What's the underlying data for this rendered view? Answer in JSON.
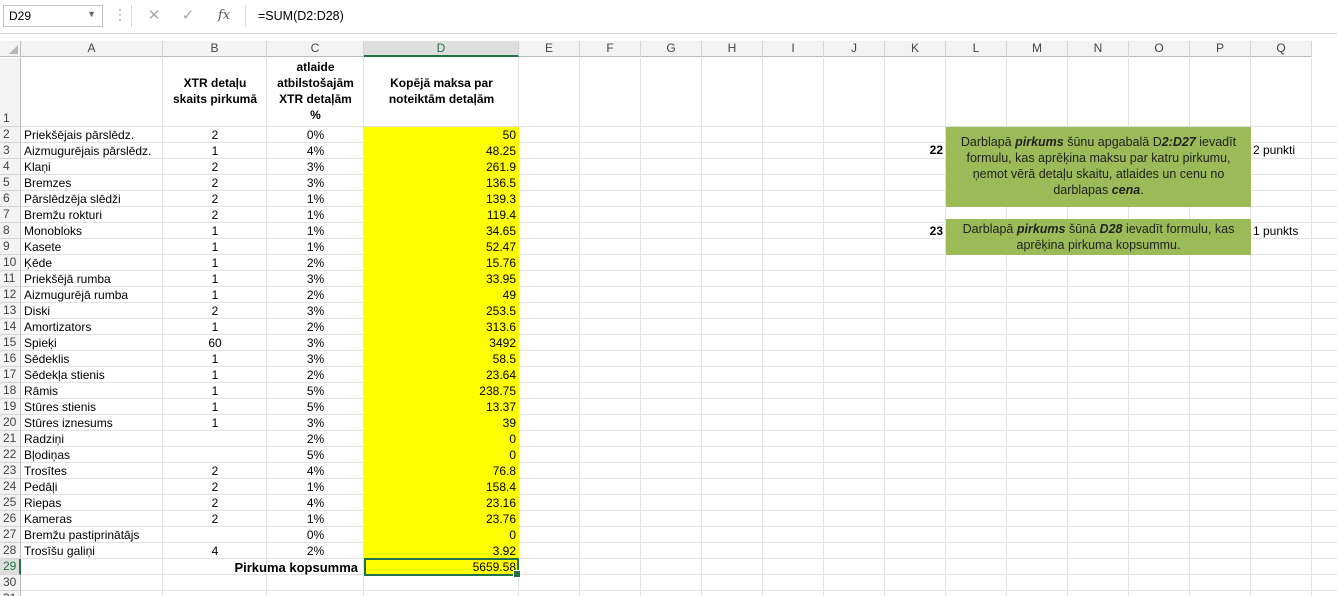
{
  "name_box": "D29",
  "formula": "=SUM(D2:D28)",
  "toolbar": {
    "dots": "⋮",
    "cancel": "✕",
    "enter": "✓",
    "fx": "fx"
  },
  "columns": [
    "A",
    "B",
    "C",
    "D",
    "E",
    "F",
    "G",
    "H",
    "I",
    "J",
    "K",
    "L",
    "M",
    "N",
    "O",
    "P",
    "Q"
  ],
  "selected_column": "D",
  "selected_row": "29",
  "header": {
    "b": [
      "XTR detaļu",
      "skaits pirkumā"
    ],
    "c": [
      "atlaide",
      "atbilstošajām",
      "XTR detaļām",
      "%"
    ],
    "d": [
      "Kopējā maksa par",
      "noteiktām detaļām"
    ]
  },
  "rows": [
    {
      "n": "2",
      "name": "Priekšējais pārslēdz.",
      "qty": "2",
      "disc": "0%",
      "total": "50"
    },
    {
      "n": "3",
      "name": "Aizmugurējais pārslēdz.",
      "qty": "1",
      "disc": "4%",
      "total": "48.25"
    },
    {
      "n": "4",
      "name": "Klaņi",
      "qty": "2",
      "disc": "3%",
      "total": "261.9"
    },
    {
      "n": "5",
      "name": "Bremzes",
      "qty": "2",
      "disc": "3%",
      "total": "136.5"
    },
    {
      "n": "6",
      "name": "Pārslēdzēja slēdži",
      "qty": "2",
      "disc": "1%",
      "total": "139.3"
    },
    {
      "n": "7",
      "name": "Bremžu rokturi",
      "qty": "2",
      "disc": "1%",
      "total": "119.4"
    },
    {
      "n": "8",
      "name": "Monobloks",
      "qty": "1",
      "disc": "1%",
      "total": "34.65"
    },
    {
      "n": "9",
      "name": "Kasete",
      "qty": "1",
      "disc": "1%",
      "total": "52.47"
    },
    {
      "n": "10",
      "name": "Ķēde",
      "qty": "1",
      "disc": "2%",
      "total": "15.76"
    },
    {
      "n": "11",
      "name": "Priekšējā rumba",
      "qty": "1",
      "disc": "3%",
      "total": "33.95"
    },
    {
      "n": "12",
      "name": "Aizmugurējā rumba",
      "qty": "1",
      "disc": "2%",
      "total": "49"
    },
    {
      "n": "13",
      "name": "Diski",
      "qty": "2",
      "disc": "3%",
      "total": "253.5"
    },
    {
      "n": "14",
      "name": "Amortizators",
      "qty": "1",
      "disc": "2%",
      "total": "313.6"
    },
    {
      "n": "15",
      "name": "Spieķi",
      "qty": "60",
      "disc": "3%",
      "total": "3492"
    },
    {
      "n": "16",
      "name": "Sēdeklis",
      "qty": "1",
      "disc": "3%",
      "total": "58.5"
    },
    {
      "n": "17",
      "name": "Sēdekļa stienis",
      "qty": "1",
      "disc": "2%",
      "total": "23.64"
    },
    {
      "n": "18",
      "name": "Rāmis",
      "qty": "1",
      "disc": "5%",
      "total": "238.75"
    },
    {
      "n": "19",
      "name": "Stūres stienis",
      "qty": "1",
      "disc": "5%",
      "total": "13.37"
    },
    {
      "n": "20",
      "name": "Stūres iznesums",
      "qty": "1",
      "disc": "3%",
      "total": "39"
    },
    {
      "n": "21",
      "name": "Radziņi",
      "qty": "",
      "disc": "2%",
      "total": "0"
    },
    {
      "n": "22",
      "name": "Bļodiņas",
      "qty": "",
      "disc": "5%",
      "total": "0"
    },
    {
      "n": "23",
      "name": "Trosītes",
      "qty": "2",
      "disc": "4%",
      "total": "76.8"
    },
    {
      "n": "24",
      "name": "Pedāļi",
      "qty": "2",
      "disc": "1%",
      "total": "158.4"
    },
    {
      "n": "25",
      "name": "Riepas",
      "qty": "2",
      "disc": "4%",
      "total": "23.16"
    },
    {
      "n": "26",
      "name": "Kameras",
      "qty": "2",
      "disc": "1%",
      "total": "23.76"
    },
    {
      "n": "27",
      "name": "Bremžu pastiprinātājs",
      "qty": "",
      "disc": "0%",
      "total": "0"
    },
    {
      "n": "28",
      "name": "Trosīšu galiņi",
      "qty": "4",
      "disc": "2%",
      "total": "3.92"
    }
  ],
  "total_label": "Pirkuma kopsumma",
  "total_value": "5659.58",
  "extra_rows": [
    "1",
    "29",
    "30",
    "31"
  ],
  "tasks": [
    {
      "num": "22",
      "points": "2 punkti",
      "parts": [
        "Darblapā ",
        "pirkums",
        " šūnu apgabalā D",
        "2:D27",
        " ievadīt formulu, kas aprēķina maksu par katru pirkumu, ņemot vērā detaļu skaitu, atlaides un cenu no darblapas ",
        "cena",
        "."
      ]
    },
    {
      "num": "23",
      "points": "1 punkts",
      "parts": [
        "Darblapā ",
        "pirkums",
        " šūnā ",
        "D28",
        " ievadīt formulu, kas aprēķina pirkuma kopsummu."
      ]
    }
  ]
}
